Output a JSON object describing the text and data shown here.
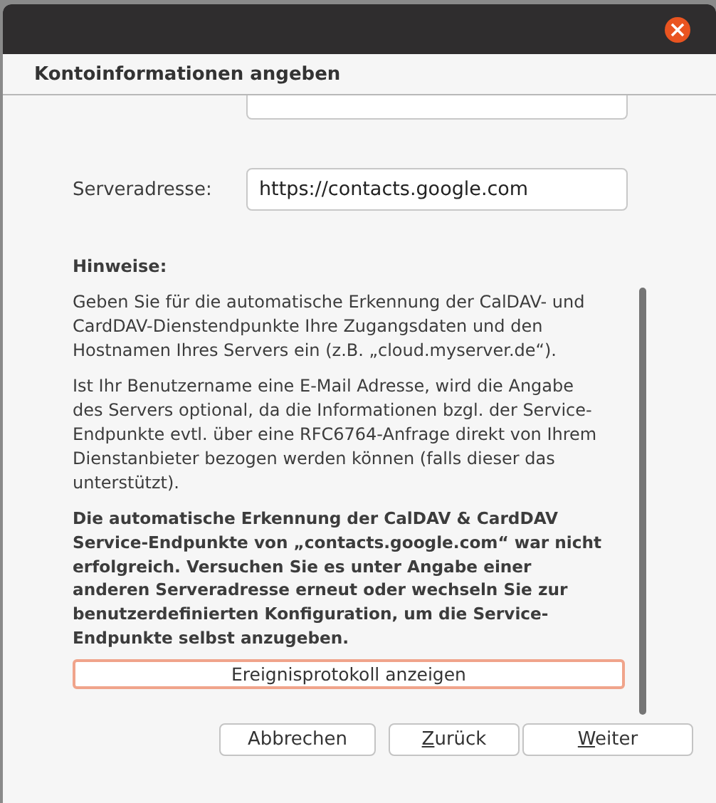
{
  "window": {
    "title": "Kontoinformationen angeben"
  },
  "fields": [
    {
      "kind": "cut"
    },
    {
      "kind": "labeled",
      "label": "Serveradresse:",
      "value": "https://contacts.google.com"
    }
  ],
  "notes": {
    "heading": "Hinweise:",
    "paragraphs": [
      {
        "bold": false,
        "text": "Geben Sie für die automatische Erkennung der CalDAV- und CardDAV-Dienstendpunkte Ihre Zugangsdaten und den Hostnamen Ihres Servers ein (z.B. „cloud.myserver.de“)."
      },
      {
        "bold": false,
        "text": "Ist Ihr Benutzername eine E-Mail Adresse, wird die Angabe des Servers optional, da die Informationen bzgl. der Service-Endpunkte evtl. über eine RFC6764-Anfrage direkt von Ihrem Dienstanbieter bezogen werden können (falls dieser das unterstützt)."
      },
      {
        "bold": true,
        "text": "Die automatische Erkennung der CalDAV & CardDAV Service-Endpunkte von „contacts.google.com“ war nicht erfolgreich. Versuchen Sie es unter Angabe einer anderen Serveradresse erneut oder wechseln Sie zur benutzerdefinierten Konfiguration, um die Service-Endpunkte selbst anzugeben."
      }
    ],
    "log_button": {
      "label": "Ereignisprotokoll anzeigen",
      "focused": true
    }
  },
  "buttons": [
    {
      "label": "Abbrechen",
      "mnemonic": false
    },
    {
      "label": "Zurück",
      "mnemonic": true
    },
    {
      "label": "Weiter",
      "mnemonic": true
    }
  ]
}
